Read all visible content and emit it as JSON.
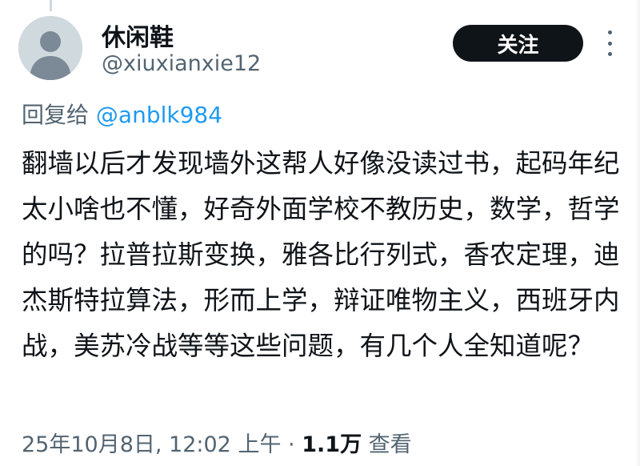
{
  "author": {
    "display_name": "休闲鞋",
    "handle": "@xiuxianxie12"
  },
  "header": {
    "follow_label": "关注",
    "more_icon": "more-vertical-icon"
  },
  "reply": {
    "prefix": "回复给",
    "mention": "@anblk984"
  },
  "tweet": {
    "text": "翻墙以后才发现墙外这帮人好像没读过书，起码年纪太小啥也不懂，好奇外面学校不教历史，数学，哲学的吗？拉普拉斯变换，雅各比行列式，香农定理，迪杰斯特拉算法，形而上学，辩证唯物主义，西班牙内战，美苏冷战等等这些问题，有几个人全知道呢？"
  },
  "meta": {
    "timestamp": "25年10月8日, 12:02 上午",
    "separator": "·",
    "views_count": "1.1万",
    "views_label": "查看"
  },
  "colors": {
    "text_primary": "#0f1419",
    "text_secondary": "#536471",
    "link": "#1d9bf0",
    "button_bg": "#0f1419",
    "avatar_bg": "#cfd9de"
  }
}
